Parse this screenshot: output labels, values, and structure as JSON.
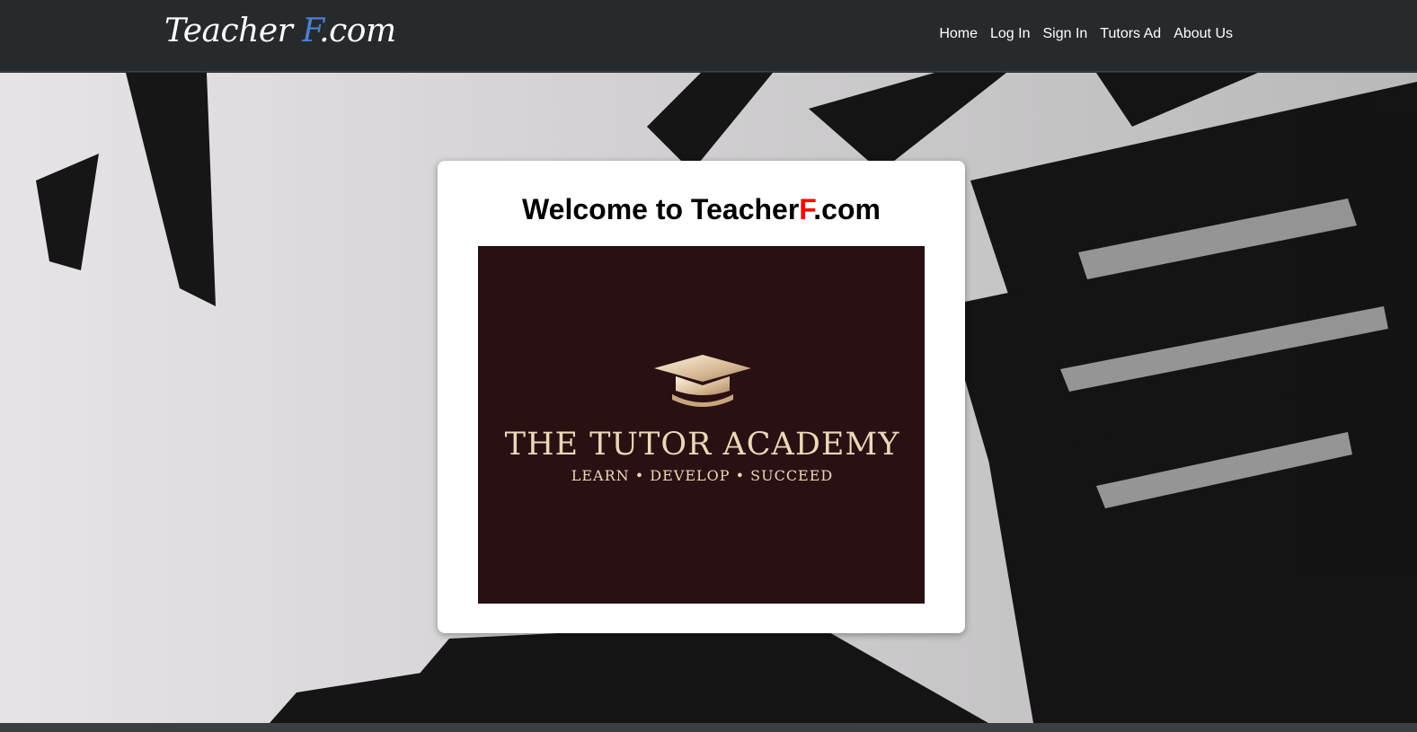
{
  "navbar": {
    "brand_main": "Teacher ",
    "brand_accent": "F",
    "brand_tail": ".com",
    "links": [
      "Home",
      "Log In",
      "Sign In",
      "Tutors Ad",
      "About Us"
    ]
  },
  "welcome": {
    "prefix": "Welcome to Teacher",
    "highlight": "F",
    "suffix": ".com"
  },
  "academy_image": {
    "title": "THE TUTOR ACADEMY",
    "tagline": "LEARN • DEVELOP • SUCCEED",
    "icon": "graduation-cap-icon"
  },
  "colors": {
    "navbar_bg": "#262a2d",
    "brand_accent": "#4b7fd6",
    "welcome_highlight": "#ff0000",
    "academy_bg": "#2a1013",
    "academy_gold": "#ecd7b8"
  }
}
